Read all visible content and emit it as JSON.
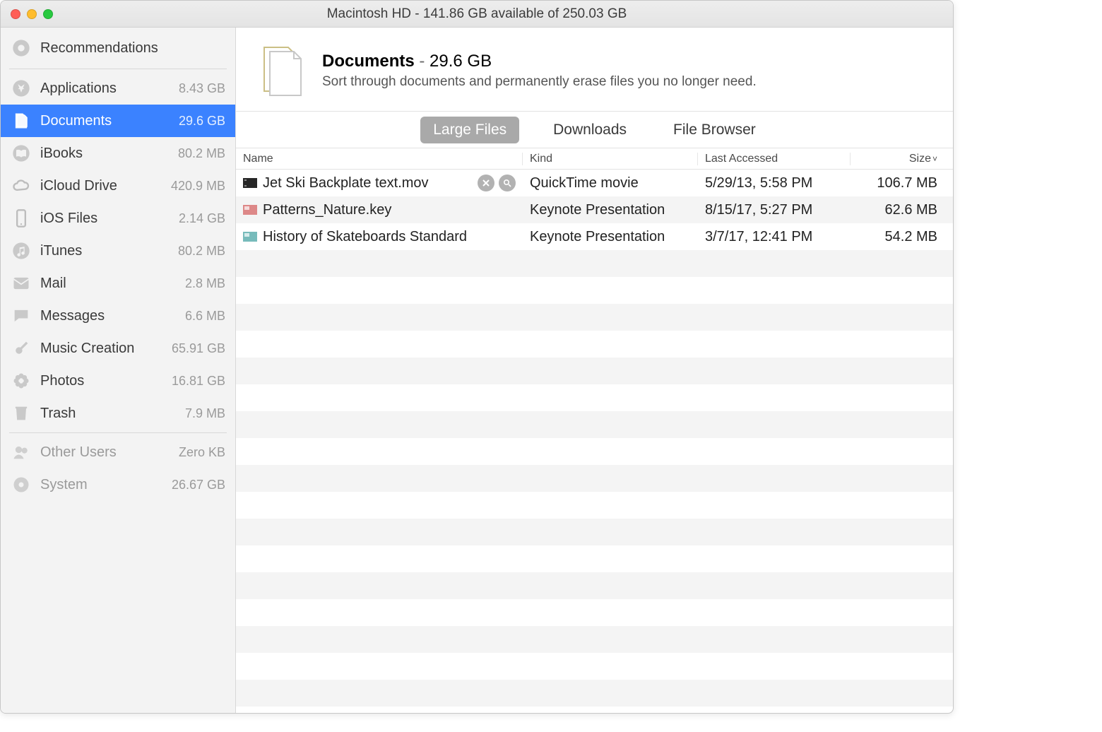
{
  "window": {
    "title": "Macintosh HD - 141.86 GB available of 250.03 GB"
  },
  "sidebar": {
    "recommendations": {
      "label": "Recommendations"
    },
    "items": [
      {
        "label": "Applications",
        "size": "8.43 GB"
      },
      {
        "label": "Documents",
        "size": "29.6 GB",
        "selected": true
      },
      {
        "label": "iBooks",
        "size": "80.2 MB"
      },
      {
        "label": "iCloud Drive",
        "size": "420.9 MB"
      },
      {
        "label": "iOS Files",
        "size": "2.14 GB"
      },
      {
        "label": "iTunes",
        "size": "80.2 MB"
      },
      {
        "label": "Mail",
        "size": "2.8 MB"
      },
      {
        "label": "Messages",
        "size": "6.6 MB"
      },
      {
        "label": "Music Creation",
        "size": "65.91 GB"
      },
      {
        "label": "Photos",
        "size": "16.81 GB"
      },
      {
        "label": "Trash",
        "size": "7.9 MB"
      }
    ],
    "footer": [
      {
        "label": "Other Users",
        "size": "Zero KB"
      },
      {
        "label": "System",
        "size": "26.67 GB"
      }
    ]
  },
  "detail": {
    "title": "Documents",
    "size": "29.6 GB",
    "subtitle": "Sort through documents and permanently erase files you no longer need."
  },
  "tabs": [
    {
      "label": "Large Files",
      "active": true
    },
    {
      "label": "Downloads",
      "active": false
    },
    {
      "label": "File Browser",
      "active": false
    }
  ],
  "columns": {
    "name": "Name",
    "kind": "Kind",
    "date": "Last Accessed",
    "size": "Size",
    "sort_indicator": "˅"
  },
  "files": [
    {
      "name": "Jet Ski Backplate text.mov",
      "kind": "QuickTime movie",
      "date": "5/29/13, 5:58 PM",
      "size": "106.7 MB",
      "hover": true
    },
    {
      "name": "Patterns_Nature.key",
      "kind": "Keynote Presentation",
      "date": "8/15/17, 5:27 PM",
      "size": "62.6 MB"
    },
    {
      "name": "History of Skateboards Standard",
      "kind": "Keynote Presentation",
      "date": "3/7/17, 12:41 PM",
      "size": "54.2 MB"
    }
  ]
}
